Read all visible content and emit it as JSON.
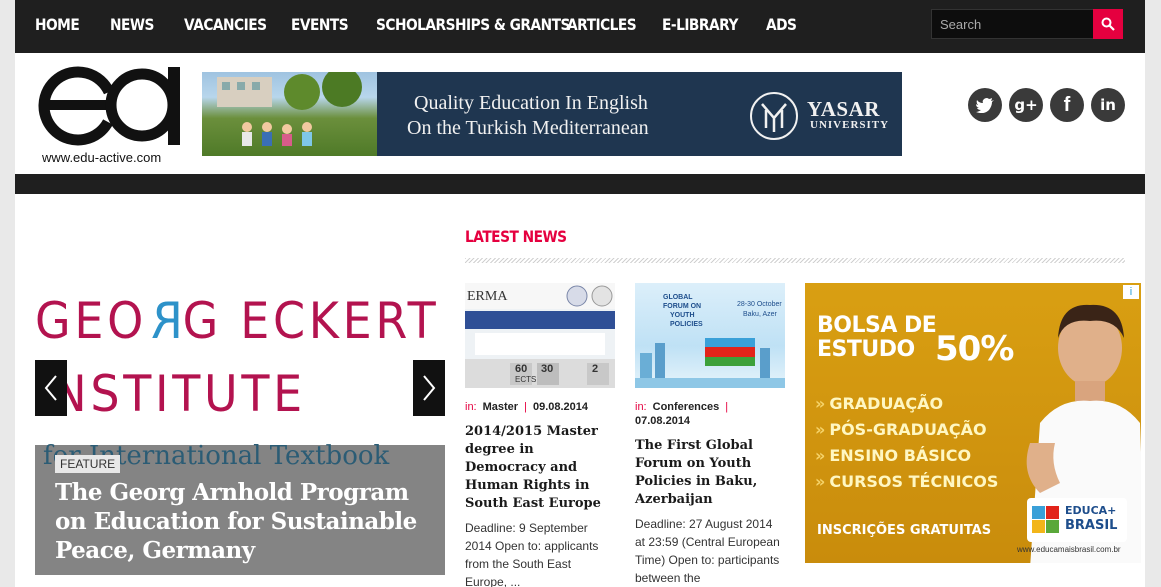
{
  "nav": {
    "items": [
      "HOME",
      "NEWS",
      "VACANCIES",
      "EVENTS",
      "SCHOLARSHIPS & GRANTS",
      "ARTICLES",
      "E-LIBRARY",
      "ADS"
    ],
    "search_placeholder": "Search"
  },
  "header": {
    "logo_text": "ea",
    "logo_url": "www.edu-active.com",
    "banner": {
      "line1": "Quality Education In English",
      "line2": "On the Turkish Mediterranean",
      "brand": "YASAR",
      "brand_sub": "UNIVERSITY"
    },
    "social": [
      {
        "icon": "twitter-icon",
        "glyph": "t"
      },
      {
        "icon": "google-plus-icon",
        "glyph": "g+"
      },
      {
        "icon": "facebook-icon",
        "glyph": "f"
      },
      {
        "icon": "linkedin-icon",
        "glyph": "in"
      }
    ]
  },
  "slider": {
    "image_line1_a": "GEO",
    "image_line1_b": "R",
    "image_line1_c": "G ECKERT",
    "image_line2": "INSTITUTE",
    "image_sub": "for International Textbook",
    "badge": "FEATURE",
    "title": "The Georg Arnhold Program on Education for Sustainable Peace, Germany"
  },
  "latest": {
    "title": "LATEST NEWS",
    "articles": [
      {
        "in_label": "in:",
        "category": "Master",
        "date": "09.08.2014",
        "title": "2014/2015 Master degree in Democracy and Human Rights in South East Europe",
        "excerpt": "Deadline: 9 September 2014 Open to: applicants from the South East Europe, ...",
        "thumb_brand": "ERMA",
        "thumb_num1": "60",
        "thumb_label1": "ECTS",
        "thumb_num2": "30",
        "thumb_num3": "2"
      },
      {
        "in_label": "in:",
        "category": "Conferences",
        "date": "07.08.2014",
        "title": "The First Global Forum on Youth Policies in Baku, Azerbaijan",
        "excerpt": "Deadline:  27 August 2014 at 23:59 (Central European Time) Open to: participants between the",
        "thumb_line1": "GLOBAL",
        "thumb_line2": "FORUM ON",
        "thumb_line3": "YOUTH",
        "thumb_line4": "POLICIES",
        "thumb_dates": "28-30 October",
        "thumb_place": "Baku, Azer"
      }
    ]
  },
  "ad": {
    "title1": "BOLSA DE",
    "title2": "ESTUDO",
    "percent": "50%",
    "items": [
      "GRADUAÇÃO",
      "PÓS-GRADUAÇÃO",
      "ENSINO BÁSICO",
      "CURSOS TÉCNICOS"
    ],
    "footer": "INSCRIÇÕES GRATUITAS",
    "brand1": "EDUCA+",
    "brand2": "BRASIL",
    "url": "www.educamaisbrasil.com.br",
    "info": "i"
  }
}
